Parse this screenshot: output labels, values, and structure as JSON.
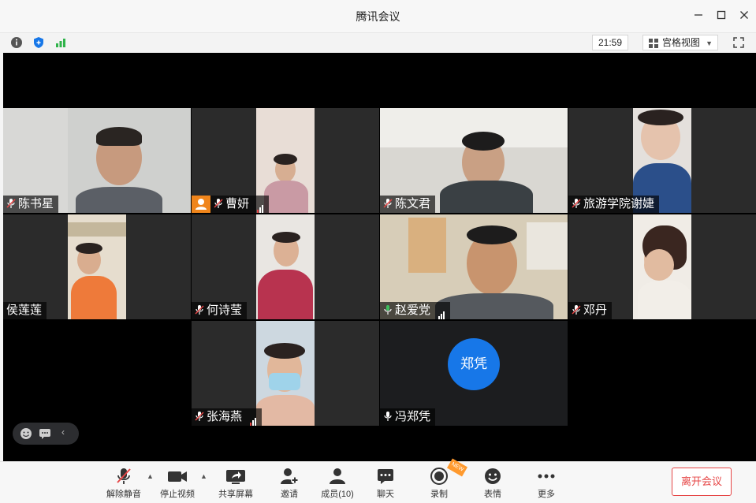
{
  "window": {
    "title": "腾讯会议"
  },
  "infobar": {
    "time": "21:59",
    "view_label": "宫格视图"
  },
  "participants": [
    {
      "name": "陈书星",
      "muted": true,
      "initials": ""
    },
    {
      "name": "曹妍",
      "muted": true,
      "host": true,
      "signal": true
    },
    {
      "name": "陈文君",
      "muted": true
    },
    {
      "name": "旅游学院谢婕",
      "muted": true
    },
    {
      "name": "侯莲莲",
      "muted": false
    },
    {
      "name": "何诗莹",
      "muted": true
    },
    {
      "name": "赵爱党",
      "muted": false,
      "speaking": true,
      "signal": true
    },
    {
      "name": "邓丹",
      "muted": true
    },
    {
      "name": "张海燕",
      "muted": true,
      "signal": true
    },
    {
      "name": "冯郑凭",
      "muted": false,
      "avatar_text": "郑凭",
      "avatar_color": "#1777e8"
    }
  ],
  "toolbar": {
    "unmute": "解除静音",
    "stop_video": "停止视频",
    "share_screen": "共享屏幕",
    "invite": "邀请",
    "members": "成员(10)",
    "chat": "聊天",
    "record": "录制",
    "reactions": "表情",
    "more": "更多",
    "leave": "离开会议",
    "new_badge": "NEW"
  },
  "colors": {
    "accent": "#1777e8",
    "leave": "#e64545",
    "active_speaker": "#3dbd5c",
    "host_badge": "#f0851b"
  }
}
